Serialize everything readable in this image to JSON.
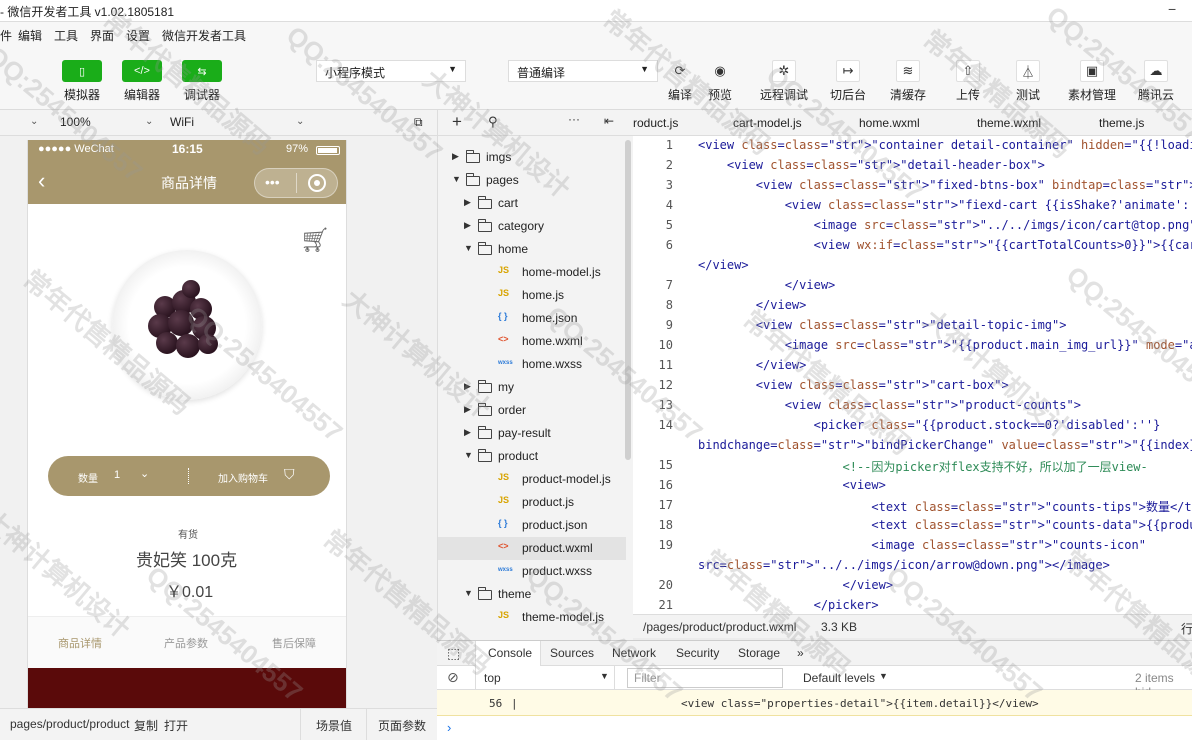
{
  "titlebar": {
    "title": "- 微信开发者工具 v1.02.1805181"
  },
  "menu": {
    "items": [
      "件",
      "编辑",
      "工具",
      "界面",
      "设置",
      "微信开发者工具"
    ]
  },
  "toolbar": {
    "left_buttons": [
      {
        "label": "模拟器",
        "icon": "phone-icon"
      },
      {
        "label": "编辑器",
        "icon": "code-icon"
      },
      {
        "label": "调试器",
        "icon": "debug-icon"
      }
    ],
    "mode_select": "小程序模式",
    "compile_select": "普通编译",
    "actions": [
      {
        "label": "编译",
        "icon": "refresh-icon"
      },
      {
        "label": "预览",
        "icon": "eye-icon"
      },
      {
        "label": "远程调试",
        "icon": "bug-icon"
      },
      {
        "label": "切后台",
        "icon": "switch-icon"
      },
      {
        "label": "清缓存",
        "icon": "layers-icon"
      },
      {
        "label": "上传",
        "icon": "upload-icon"
      },
      {
        "label": "测试",
        "icon": "flask-icon"
      },
      {
        "label": "素材管理",
        "icon": "folder-icon"
      },
      {
        "label": "腾讯云",
        "icon": "cloud-icon"
      }
    ]
  },
  "simulator": {
    "zoom": "100%",
    "network": "WiFi",
    "status": {
      "carrier": "●●●●● WeChat",
      "time": "16:15",
      "battery": "97%"
    },
    "nav_title": "商品详情",
    "cart_bar": {
      "qty_label": "数量",
      "qty": "1",
      "add_label": "加入购物车"
    },
    "stock": "有货",
    "name": "贵妃笑 100克",
    "price": "￥0.01",
    "tabs": [
      "商品详情",
      "产品参数",
      "售后保障"
    ],
    "bottom": {
      "path": "pages/product/product",
      "copy": "复制",
      "open": "打开",
      "scene": "场景值",
      "params": "页面参数"
    }
  },
  "tree": {
    "items": [
      {
        "name": "imgs",
        "type": "folder",
        "depth": 0,
        "open": false
      },
      {
        "name": "pages",
        "type": "folder",
        "depth": 0,
        "open": true
      },
      {
        "name": "cart",
        "type": "folder",
        "depth": 1,
        "open": false
      },
      {
        "name": "category",
        "type": "folder",
        "depth": 1,
        "open": false
      },
      {
        "name": "home",
        "type": "folder",
        "depth": 1,
        "open": true
      },
      {
        "name": "home-model.js",
        "type": "js",
        "depth": 2
      },
      {
        "name": "home.js",
        "type": "js",
        "depth": 2
      },
      {
        "name": "home.json",
        "type": "json",
        "depth": 2
      },
      {
        "name": "home.wxml",
        "type": "wxml",
        "depth": 2
      },
      {
        "name": "home.wxss",
        "type": "wxss",
        "depth": 2
      },
      {
        "name": "my",
        "type": "folder",
        "depth": 1,
        "open": false
      },
      {
        "name": "order",
        "type": "folder",
        "depth": 1,
        "open": false
      },
      {
        "name": "pay-result",
        "type": "folder",
        "depth": 1,
        "open": false
      },
      {
        "name": "product",
        "type": "folder",
        "depth": 1,
        "open": true
      },
      {
        "name": "product-model.js",
        "type": "js",
        "depth": 2
      },
      {
        "name": "product.js",
        "type": "js",
        "depth": 2
      },
      {
        "name": "product.json",
        "type": "json",
        "depth": 2
      },
      {
        "name": "product.wxml",
        "type": "wxml",
        "depth": 2,
        "selected": true
      },
      {
        "name": "product.wxss",
        "type": "wxss",
        "depth": 2
      },
      {
        "name": "theme",
        "type": "folder",
        "depth": 1,
        "open": true
      },
      {
        "name": "theme-model.js",
        "type": "js",
        "depth": 2
      }
    ]
  },
  "editor": {
    "tabs": [
      "roduct.js",
      "cart-model.js",
      "home.wxml",
      "theme.wxml",
      "theme.js"
    ],
    "lines": [
      {
        "n": "1",
        "text": "<view class=\"container detail-container\" hidden=\"{{!loadingHidde"
      },
      {
        "n": "2",
        "text": "    <view class=\"detail-header-box\">"
      },
      {
        "n": "3",
        "text": "        <view class=\"fixed-btns-box\" bindtap=\"onCartTap\">"
      },
      {
        "n": "4",
        "text": "            <view class=\"fiexd-cart {{isShake?'animate':''}}\">"
      },
      {
        "n": "5",
        "text": "                <image src=\"../../imgs/icon/cart@top.png\"></image"
      },
      {
        "n": "6",
        "text": "                <view wx:if=\"{{cartTotalCounts>0}}\">{{cartTotalCo"
      },
      {
        "n": "",
        "text": "</view>"
      },
      {
        "n": "7",
        "text": "            </view>"
      },
      {
        "n": "8",
        "text": "        </view>"
      },
      {
        "n": "9",
        "text": "        <view class=\"detail-topic-img\">"
      },
      {
        "n": "10",
        "text": "            <image src=\"{{product.main_img_url}}\" mode=\"aspectFit"
      },
      {
        "n": "11",
        "text": "        </view>"
      },
      {
        "n": "12",
        "text": "        <view class=\"cart-box\">"
      },
      {
        "n": "13",
        "text": "            <view class=\"product-counts\">"
      },
      {
        "n": "14",
        "text": "                <picker class=\"{{product.stock==0?'disabled':''}"
      },
      {
        "n": "",
        "text": "bindchange=\"bindPickerChange\" value=\"{{index}}\" range=\"{{countsA"
      },
      {
        "n": "15",
        "text": "                    <!--因为picker对flex支持不好，所以加了一层view-"
      },
      {
        "n": "16",
        "text": "                    <view>"
      },
      {
        "n": "17",
        "text": "                        <text class=\"counts-tips\">数量</text>"
      },
      {
        "n": "18",
        "text": "                        <text class=\"counts-data\">{{productCount"
      },
      {
        "n": "19",
        "text": "                        <image class=\"counts-icon\""
      },
      {
        "n": "",
        "text": "src=\"../../imgs/icon/arrow@down.png\"></image>"
      },
      {
        "n": "20",
        "text": "                    </view>"
      },
      {
        "n": "21",
        "text": "                </picker>"
      }
    ],
    "status_path": "/pages/product/product.wxml",
    "status_size": "3.3 KB",
    "status_right": "行"
  },
  "console": {
    "tabs": [
      "Console",
      "Sources",
      "Network",
      "Security",
      "Storage"
    ],
    "context": "top",
    "filter_placeholder": "Filter",
    "levels": "Default levels",
    "hidden": "2 items hid",
    "log_line_num": "56",
    "log_text": "<view class=\"properties-detail\">{{item.detail}}</view>"
  },
  "watermarks": [
    "QQ:2545404557",
    "常年代售精品源码",
    "大神计算机设计",
    "常年售精品源码"
  ]
}
